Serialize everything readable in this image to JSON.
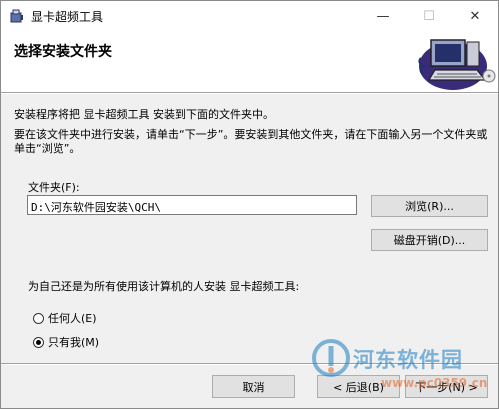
{
  "window": {
    "title": "显卡超频工具",
    "controls": {
      "minimize": "—",
      "maximize": "☐",
      "close": "✕"
    }
  },
  "header": {
    "title": "选择安装文件夹",
    "art_icon": "computer-setup-icon"
  },
  "body": {
    "description_1": "安装程序将把 显卡超频工具 安装到下面的文件夹中。",
    "description_2": "要在该文件夹中进行安装，请单击“下一步”。要安装到其他文件夹，请在下面输入另一个文件夹或单击“浏览”。",
    "folder_label": "文件夹(F):",
    "folder_value": "D:\\河东软件园安装\\QCH\\",
    "browse_button": "浏览(R)...",
    "disk_cost_button": "磁盘开销(D)...",
    "install_for_label": "为自己还是为所有使用该计算机的人安装 显卡超频工具:",
    "radio_options": [
      {
        "label": "任何人(E)",
        "checked": false
      },
      {
        "label": "只有我(M)",
        "checked": true
      }
    ]
  },
  "footer": {
    "cancel_button": "取消",
    "back_button": "< 后退(B)",
    "next_button": "下一步(N) >"
  },
  "watermark": {
    "text": "河东软件园",
    "url": "www.pc0359.cn",
    "color_primary": "#1e7fc3",
    "color_secondary": "#e0662a"
  }
}
